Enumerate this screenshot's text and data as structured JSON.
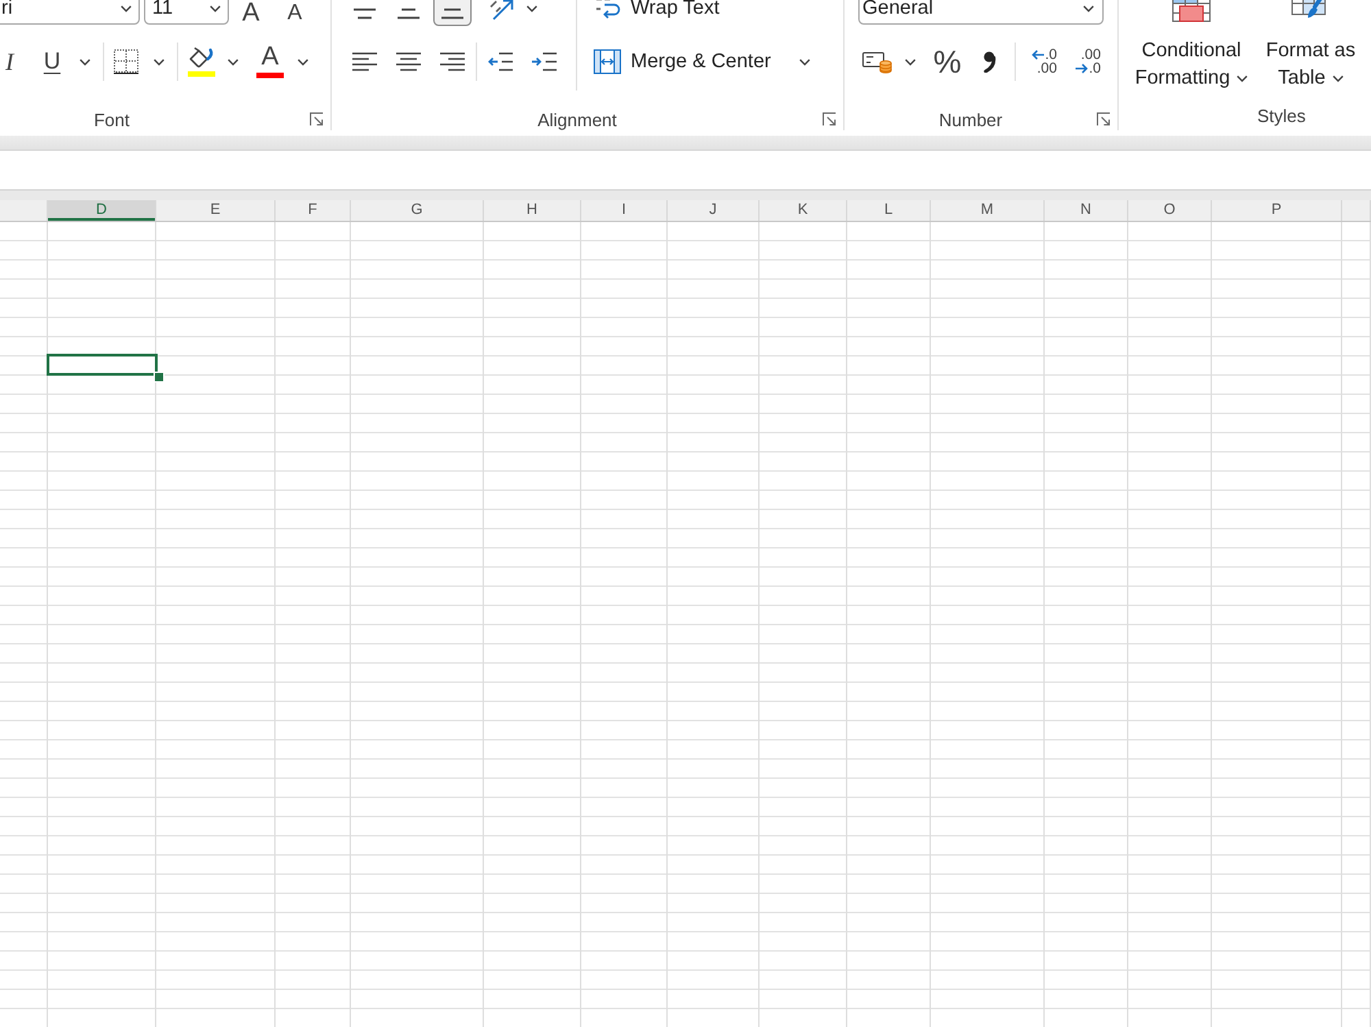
{
  "ribbon": {
    "font": {
      "label": "Font",
      "font_name": "ri",
      "font_size": "11",
      "size_buttons": [
        {
          "kind": "grow",
          "label": "A"
        },
        {
          "kind": "shrink",
          "label": "A"
        }
      ],
      "italic": "I",
      "underline": "U",
      "fill_color": {
        "color": "#ffff00"
      },
      "font_color": {
        "label": "A",
        "color": "#ff0000"
      }
    },
    "alignment": {
      "label": "Alignment",
      "vertical": [
        {
          "kind": "top",
          "selected": false
        },
        {
          "kind": "middle",
          "selected": false
        },
        {
          "kind": "bottom",
          "selected": true
        }
      ],
      "horizontal": [
        {
          "kind": "left",
          "selected": false
        },
        {
          "kind": "center",
          "selected": false
        },
        {
          "kind": "right",
          "selected": false
        }
      ],
      "indent": [
        {
          "kind": "decrease"
        },
        {
          "kind": "increase"
        }
      ],
      "wrap_text": "Wrap Text",
      "merge": "Merge & Center"
    },
    "number": {
      "label": "Number",
      "format": "General",
      "percent": "%",
      "decimals": [
        {
          "kind": "increase",
          "top": ".0",
          "bottom": ".00"
        },
        {
          "kind": "decrease",
          "top": ".00",
          "bottom": ".0"
        }
      ]
    },
    "styles": {
      "label": "Styles",
      "buttons": [
        {
          "kind": "conditional",
          "lines": [
            "Conditional",
            "Formatting"
          ]
        },
        {
          "kind": "table",
          "lines": [
            "Format as",
            "Table"
          ]
        }
      ]
    }
  },
  "sheet": {
    "columns": [
      {
        "label": "D",
        "selected": true
      },
      {
        "label": "E",
        "selected": false
      },
      {
        "label": "F",
        "selected": false
      },
      {
        "label": "G",
        "selected": false
      },
      {
        "label": "H",
        "selected": false
      },
      {
        "label": "I",
        "selected": false
      },
      {
        "label": "J",
        "selected": false
      },
      {
        "label": "K",
        "selected": false
      },
      {
        "label": "L",
        "selected": false
      },
      {
        "label": "M",
        "selected": false
      },
      {
        "label": "N",
        "selected": false
      },
      {
        "label": "O",
        "selected": false
      },
      {
        "label": "P",
        "selected": false
      }
    ]
  }
}
